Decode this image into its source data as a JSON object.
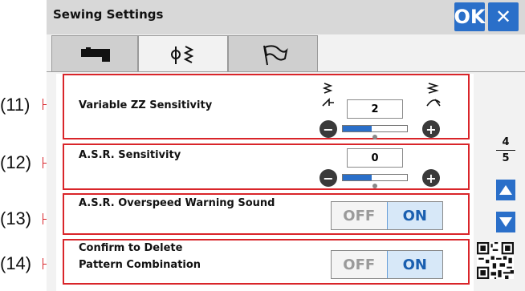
{
  "title": "Sewing Settings",
  "ok_label": "OK",
  "close_label": "✕",
  "tabs": [
    {
      "name": "machine",
      "icon": "sewing-machine-icon",
      "active": false
    },
    {
      "name": "stitch",
      "icon": "stitch-icon",
      "active": true
    },
    {
      "name": "flag",
      "icon": "flag-icon",
      "active": false
    }
  ],
  "callouts": [
    "(11)",
    "(12)",
    "(13)",
    "(14)"
  ],
  "settings": [
    {
      "label": "Variable ZZ Sensitivity",
      "value": "2",
      "minus": "−",
      "plus": "+",
      "slider_fraction": 0.45
    },
    {
      "label": "A.S.R. Sensitivity",
      "value": "0",
      "minus": "−",
      "plus": "+",
      "slider_fraction": 0.45
    },
    {
      "label": "A.S.R. Overspeed Warning Sound",
      "off": "OFF",
      "on": "ON",
      "state": "ON"
    },
    {
      "label_line1": "Confirm to Delete",
      "label_line2": "Pattern Combination",
      "off": "OFF",
      "on": "ON",
      "state": "ON"
    }
  ],
  "pager": {
    "current": "4",
    "total": "5"
  },
  "colors": {
    "accent": "#2a6fc9",
    "callout_frame": "#d9252a"
  }
}
